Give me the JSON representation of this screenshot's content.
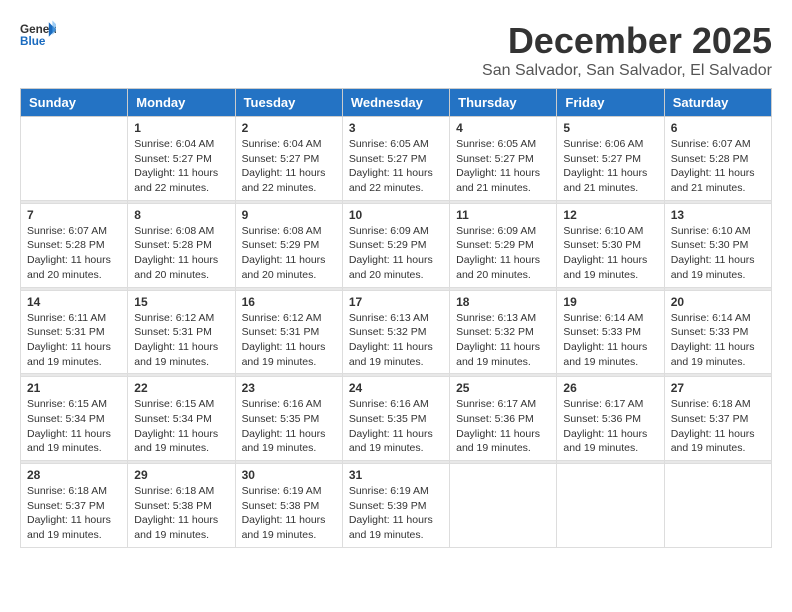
{
  "logo": {
    "text_general": "General",
    "text_blue": "Blue"
  },
  "title": {
    "month": "December 2025",
    "location": "San Salvador, San Salvador, El Salvador"
  },
  "headers": [
    "Sunday",
    "Monday",
    "Tuesday",
    "Wednesday",
    "Thursday",
    "Friday",
    "Saturday"
  ],
  "weeks": [
    [
      {
        "day": "",
        "sunrise": "",
        "sunset": "",
        "daylight": ""
      },
      {
        "day": "1",
        "sunrise": "Sunrise: 6:04 AM",
        "sunset": "Sunset: 5:27 PM",
        "daylight": "Daylight: 11 hours and 22 minutes."
      },
      {
        "day": "2",
        "sunrise": "Sunrise: 6:04 AM",
        "sunset": "Sunset: 5:27 PM",
        "daylight": "Daylight: 11 hours and 22 minutes."
      },
      {
        "day": "3",
        "sunrise": "Sunrise: 6:05 AM",
        "sunset": "Sunset: 5:27 PM",
        "daylight": "Daylight: 11 hours and 22 minutes."
      },
      {
        "day": "4",
        "sunrise": "Sunrise: 6:05 AM",
        "sunset": "Sunset: 5:27 PM",
        "daylight": "Daylight: 11 hours and 21 minutes."
      },
      {
        "day": "5",
        "sunrise": "Sunrise: 6:06 AM",
        "sunset": "Sunset: 5:27 PM",
        "daylight": "Daylight: 11 hours and 21 minutes."
      },
      {
        "day": "6",
        "sunrise": "Sunrise: 6:07 AM",
        "sunset": "Sunset: 5:28 PM",
        "daylight": "Daylight: 11 hours and 21 minutes."
      }
    ],
    [
      {
        "day": "7",
        "sunrise": "Sunrise: 6:07 AM",
        "sunset": "Sunset: 5:28 PM",
        "daylight": "Daylight: 11 hours and 20 minutes."
      },
      {
        "day": "8",
        "sunrise": "Sunrise: 6:08 AM",
        "sunset": "Sunset: 5:28 PM",
        "daylight": "Daylight: 11 hours and 20 minutes."
      },
      {
        "day": "9",
        "sunrise": "Sunrise: 6:08 AM",
        "sunset": "Sunset: 5:29 PM",
        "daylight": "Daylight: 11 hours and 20 minutes."
      },
      {
        "day": "10",
        "sunrise": "Sunrise: 6:09 AM",
        "sunset": "Sunset: 5:29 PM",
        "daylight": "Daylight: 11 hours and 20 minutes."
      },
      {
        "day": "11",
        "sunrise": "Sunrise: 6:09 AM",
        "sunset": "Sunset: 5:29 PM",
        "daylight": "Daylight: 11 hours and 20 minutes."
      },
      {
        "day": "12",
        "sunrise": "Sunrise: 6:10 AM",
        "sunset": "Sunset: 5:30 PM",
        "daylight": "Daylight: 11 hours and 19 minutes."
      },
      {
        "day": "13",
        "sunrise": "Sunrise: 6:10 AM",
        "sunset": "Sunset: 5:30 PM",
        "daylight": "Daylight: 11 hours and 19 minutes."
      }
    ],
    [
      {
        "day": "14",
        "sunrise": "Sunrise: 6:11 AM",
        "sunset": "Sunset: 5:31 PM",
        "daylight": "Daylight: 11 hours and 19 minutes."
      },
      {
        "day": "15",
        "sunrise": "Sunrise: 6:12 AM",
        "sunset": "Sunset: 5:31 PM",
        "daylight": "Daylight: 11 hours and 19 minutes."
      },
      {
        "day": "16",
        "sunrise": "Sunrise: 6:12 AM",
        "sunset": "Sunset: 5:31 PM",
        "daylight": "Daylight: 11 hours and 19 minutes."
      },
      {
        "day": "17",
        "sunrise": "Sunrise: 6:13 AM",
        "sunset": "Sunset: 5:32 PM",
        "daylight": "Daylight: 11 hours and 19 minutes."
      },
      {
        "day": "18",
        "sunrise": "Sunrise: 6:13 AM",
        "sunset": "Sunset: 5:32 PM",
        "daylight": "Daylight: 11 hours and 19 minutes."
      },
      {
        "day": "19",
        "sunrise": "Sunrise: 6:14 AM",
        "sunset": "Sunset: 5:33 PM",
        "daylight": "Daylight: 11 hours and 19 minutes."
      },
      {
        "day": "20",
        "sunrise": "Sunrise: 6:14 AM",
        "sunset": "Sunset: 5:33 PM",
        "daylight": "Daylight: 11 hours and 19 minutes."
      }
    ],
    [
      {
        "day": "21",
        "sunrise": "Sunrise: 6:15 AM",
        "sunset": "Sunset: 5:34 PM",
        "daylight": "Daylight: 11 hours and 19 minutes."
      },
      {
        "day": "22",
        "sunrise": "Sunrise: 6:15 AM",
        "sunset": "Sunset: 5:34 PM",
        "daylight": "Daylight: 11 hours and 19 minutes."
      },
      {
        "day": "23",
        "sunrise": "Sunrise: 6:16 AM",
        "sunset": "Sunset: 5:35 PM",
        "daylight": "Daylight: 11 hours and 19 minutes."
      },
      {
        "day": "24",
        "sunrise": "Sunrise: 6:16 AM",
        "sunset": "Sunset: 5:35 PM",
        "daylight": "Daylight: 11 hours and 19 minutes."
      },
      {
        "day": "25",
        "sunrise": "Sunrise: 6:17 AM",
        "sunset": "Sunset: 5:36 PM",
        "daylight": "Daylight: 11 hours and 19 minutes."
      },
      {
        "day": "26",
        "sunrise": "Sunrise: 6:17 AM",
        "sunset": "Sunset: 5:36 PM",
        "daylight": "Daylight: 11 hours and 19 minutes."
      },
      {
        "day": "27",
        "sunrise": "Sunrise: 6:18 AM",
        "sunset": "Sunset: 5:37 PM",
        "daylight": "Daylight: 11 hours and 19 minutes."
      }
    ],
    [
      {
        "day": "28",
        "sunrise": "Sunrise: 6:18 AM",
        "sunset": "Sunset: 5:37 PM",
        "daylight": "Daylight: 11 hours and 19 minutes."
      },
      {
        "day": "29",
        "sunrise": "Sunrise: 6:18 AM",
        "sunset": "Sunset: 5:38 PM",
        "daylight": "Daylight: 11 hours and 19 minutes."
      },
      {
        "day": "30",
        "sunrise": "Sunrise: 6:19 AM",
        "sunset": "Sunset: 5:38 PM",
        "daylight": "Daylight: 11 hours and 19 minutes."
      },
      {
        "day": "31",
        "sunrise": "Sunrise: 6:19 AM",
        "sunset": "Sunset: 5:39 PM",
        "daylight": "Daylight: 11 hours and 19 minutes."
      },
      {
        "day": "",
        "sunrise": "",
        "sunset": "",
        "daylight": ""
      },
      {
        "day": "",
        "sunrise": "",
        "sunset": "",
        "daylight": ""
      },
      {
        "day": "",
        "sunrise": "",
        "sunset": "",
        "daylight": ""
      }
    ]
  ]
}
